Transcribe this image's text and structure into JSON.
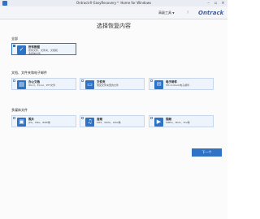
{
  "window": {
    "title": "Ontrack® EasyRecovery™ Home for Windows"
  },
  "header": {
    "menu_label": "高级工具",
    "help_label": "?",
    "logo": "Ontrack"
  },
  "page": {
    "title": "选择恢复内容"
  },
  "sections": {
    "all": {
      "title": "全部",
      "cards": [
        {
          "title": "所有数据",
          "desc1": "所有文件、文件夹、文档和",
          "desc2": "多媒体文件",
          "icon": "check-icon"
        }
      ]
    },
    "docs": {
      "title": "文档、文件夹和电子邮件",
      "cards": [
        {
          "title": "办公文档",
          "desc1": "Word、Excel、PPT文件",
          "icon": "document-icon"
        },
        {
          "title": "文件夹",
          "desc1": "恢复文件夹里的文件",
          "icon": "folder-icon"
        },
        {
          "title": "电子邮件",
          "desc1": "MS Outlook电子邮件",
          "icon": "mail-icon"
        }
      ]
    },
    "media": {
      "title": "多媒体文件",
      "cards": [
        {
          "title": "照片",
          "desc1": "JPG、PNG、BMP等",
          "icon": "photo-icon"
        },
        {
          "title": "音频",
          "desc1": "MP3、WMA、WAV等",
          "icon": "music-icon"
        },
        {
          "title": "视频",
          "desc1": "MPEG、MOV、FLV等",
          "icon": "video-icon"
        }
      ]
    }
  },
  "footer": {
    "next_label": "下一个"
  }
}
